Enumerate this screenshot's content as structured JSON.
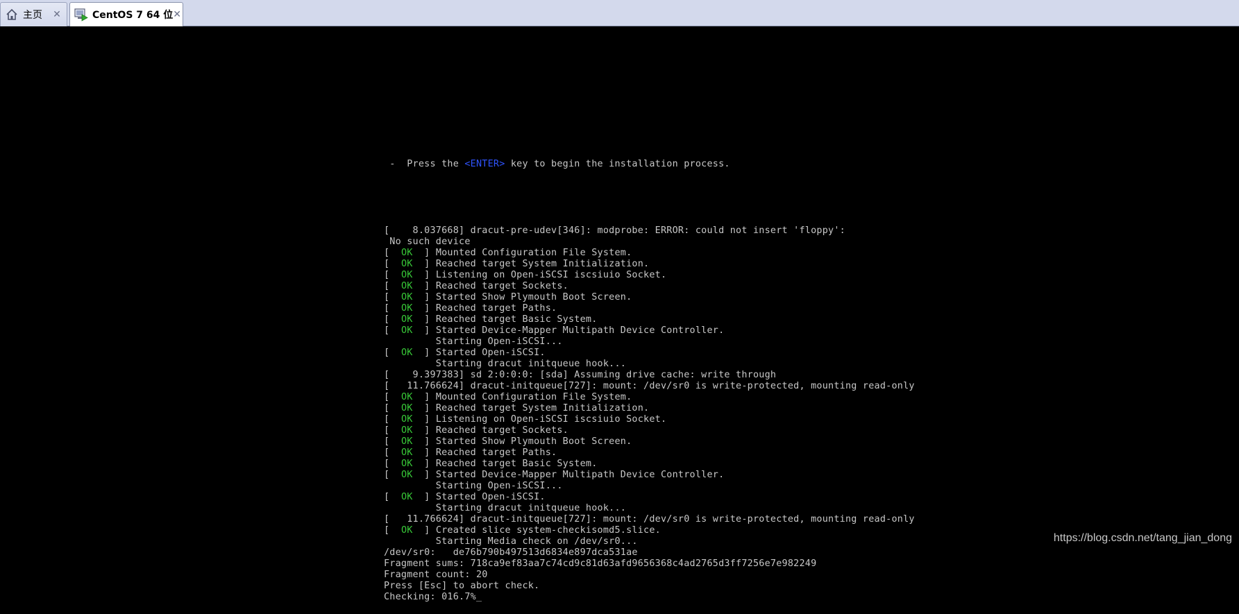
{
  "tabs": [
    {
      "label": "主页",
      "icon": "home-icon",
      "close": "✕"
    },
    {
      "label": "CentOS 7 64 位",
      "icon": "vm-running-icon",
      "close": "✕"
    }
  ],
  "console": {
    "press_pre": " -  Press the ",
    "press_key": "<ENTER>",
    "press_post": " key to begin the installation process.",
    "blank": "",
    "lines_a": [
      {
        "text": "[    8.037668] dracut-pre-udev[346]: modprobe: ERROR: could not insert 'floppy':"
      },
      {
        "text": " No such device"
      },
      {
        "ok": true,
        "text": "Mounted Configuration File System."
      },
      {
        "ok": true,
        "text": "Reached target System Initialization."
      },
      {
        "ok": true,
        "text": "Listening on Open-iSCSI iscsiuio Socket."
      },
      {
        "ok": true,
        "text": "Reached target Sockets."
      },
      {
        "ok": true,
        "text": "Started Show Plymouth Boot Screen."
      },
      {
        "ok": true,
        "text": "Reached target Paths."
      },
      {
        "ok": true,
        "text": "Reached target Basic System."
      },
      {
        "ok": true,
        "text": "Started Device-Mapper Multipath Device Controller."
      },
      {
        "text": "         Starting Open-iSCSI..."
      },
      {
        "ok": true,
        "text": "Started Open-iSCSI."
      },
      {
        "text": "         Starting dracut initqueue hook..."
      },
      {
        "text": "[    9.397383] sd 2:0:0:0: [sda] Assuming drive cache: write through"
      },
      {
        "text": "[   11.766624] dracut-initqueue[727]: mount: /dev/sr0 is write-protected, mounting read-only"
      },
      {
        "ok": true,
        "text": "Mounted Configuration File System."
      },
      {
        "ok": true,
        "text": "Reached target System Initialization."
      },
      {
        "ok": true,
        "text": "Listening on Open-iSCSI iscsiuio Socket."
      },
      {
        "ok": true,
        "text": "Reached target Sockets."
      },
      {
        "ok": true,
        "text": "Started Show Plymouth Boot Screen."
      },
      {
        "ok": true,
        "text": "Reached target Paths."
      },
      {
        "ok": true,
        "text": "Reached target Basic System."
      },
      {
        "ok": true,
        "text": "Started Device-Mapper Multipath Device Controller."
      },
      {
        "text": "         Starting Open-iSCSI..."
      },
      {
        "ok": true,
        "text": "Started Open-iSCSI."
      },
      {
        "text": "         Starting dracut initqueue hook..."
      },
      {
        "text": "[   11.766624] dracut-initqueue[727]: mount: /dev/sr0 is write-protected, mounting read-only"
      },
      {
        "ok": true,
        "text": "Created slice system-checkisomd5.slice."
      },
      {
        "text": "         Starting Media check on /dev/sr0..."
      },
      {
        "text": "/dev/sr0:   de76b790b497513d6834e897dca531ae"
      },
      {
        "text": "Fragment sums: 718ca9ef83aa7c74cd9c81d63afd9656368c4ad2765d3ff7256e7e982249"
      },
      {
        "text": "Fragment count: 20"
      },
      {
        "text": "Press [Esc] to abort check."
      },
      {
        "text": "Checking: 016.7%"
      }
    ],
    "ok_prefix_open": "[  ",
    "ok_word": "OK",
    "ok_prefix_close": "  ] ",
    "cursor": "_"
  },
  "watermark": "https://blog.csdn.net/tang_jian_dong",
  "colors": {
    "ok_green": "#38c938",
    "enter_blue": "#2f54ff",
    "console_text": "#c8c8c8",
    "background": "#000000",
    "tabbar": "#d3d9ec"
  }
}
